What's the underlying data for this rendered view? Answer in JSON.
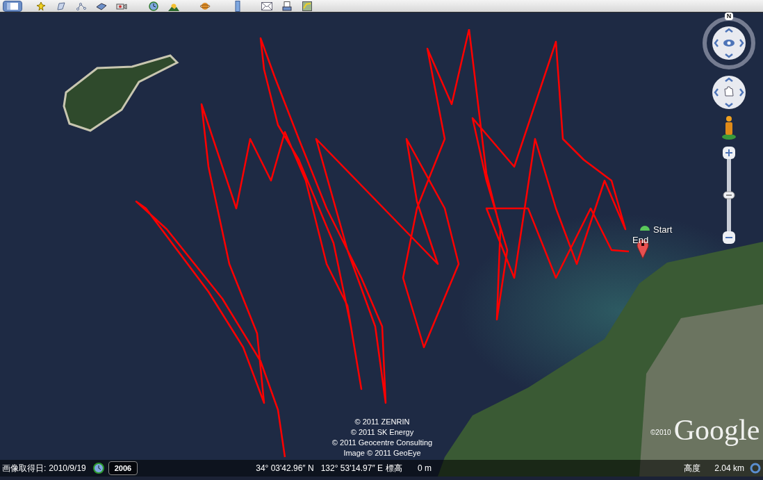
{
  "compass": {
    "north": "N"
  },
  "zoom_slider": {
    "level": 0.5
  },
  "placemarks": [
    {
      "kind": "end",
      "label": "End"
    },
    {
      "kind": "start",
      "label": "Start"
    }
  ],
  "attribution": [
    "© 2011 ZENRIN",
    "© 2011 SK Energy",
    "© 2011 Geocentre Consulting",
    "Image © 2011 GeoEye"
  ],
  "logo": {
    "year": "©2010",
    "text": "Google"
  },
  "status_bar": {
    "imagery_date_label": "画像取得日:",
    "imagery_date": "2010/9/19",
    "historical_year": "2006",
    "latitude": "34° 03'42.96″ N",
    "longitude": "132° 53'14.97″ E",
    "elevation_label": "標高",
    "elevation": "0 m",
    "altitude_label": "高度",
    "altitude": "2.04 km"
  }
}
